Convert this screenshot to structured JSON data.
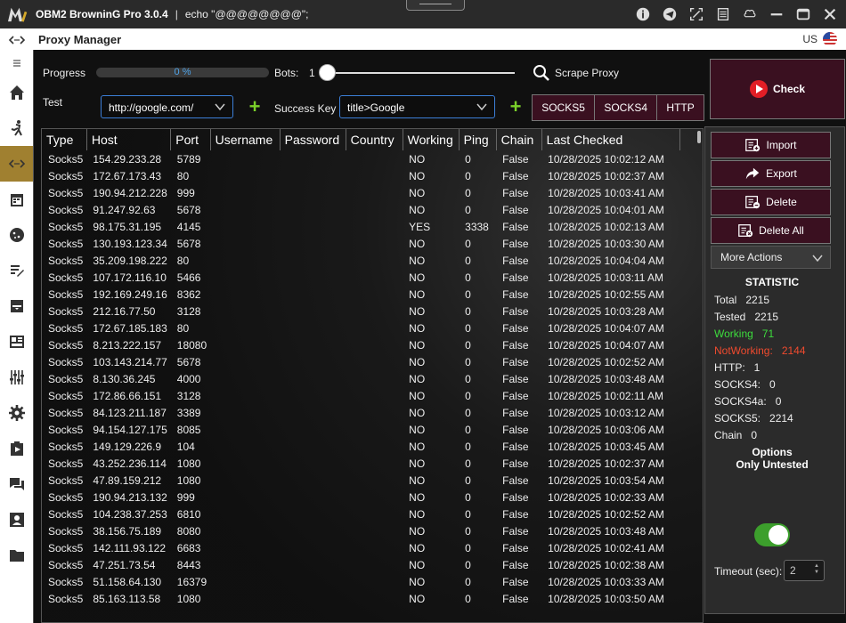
{
  "window": {
    "app_title": "OBM2 BrowninG Pro  3.0.4",
    "separator": "|",
    "echo_text": "echo \"@@@@@@@@\";"
  },
  "header": {
    "title": "Proxy Manager",
    "language": "US"
  },
  "controls": {
    "progress_label": "Progress",
    "progress_text": "0 %",
    "progress_value": 0,
    "bots_label": "Bots:",
    "bots_value": "1",
    "scrape_label": "Scrape Proxy",
    "test_label": "Test",
    "test_url": "http://google.com/",
    "success_key_label": "Success Key",
    "success_key_value": "title>Google",
    "protocols": [
      "SOCKS5",
      "SOCKS4",
      "HTTP"
    ],
    "check_label": "Check"
  },
  "table": {
    "columns": [
      "Type",
      "Host",
      "Port",
      "Username",
      "Password",
      "Country",
      "Working",
      "Ping",
      "Chain",
      "Last Checked"
    ],
    "rows": [
      [
        "Socks5",
        "154.29.233.28",
        "5789",
        "",
        "",
        "",
        "NO",
        "0",
        "False",
        "10/28/2025 10:02:12 AM"
      ],
      [
        "Socks5",
        "172.67.173.43",
        "80",
        "",
        "",
        "",
        "NO",
        "0",
        "False",
        "10/28/2025 10:02:37 AM"
      ],
      [
        "Socks5",
        "190.94.212.228",
        "999",
        "",
        "",
        "",
        "NO",
        "0",
        "False",
        "10/28/2025 10:03:41 AM"
      ],
      [
        "Socks5",
        "91.247.92.63",
        "5678",
        "",
        "",
        "",
        "NO",
        "0",
        "False",
        "10/28/2025 10:04:01 AM"
      ],
      [
        "Socks5",
        "98.175.31.195",
        "4145",
        "",
        "",
        "",
        "YES",
        "3338",
        "False",
        "10/28/2025 10:02:13 AM"
      ],
      [
        "Socks5",
        "130.193.123.34",
        "5678",
        "",
        "",
        "",
        "NO",
        "0",
        "False",
        "10/28/2025 10:03:30 AM"
      ],
      [
        "Socks5",
        "35.209.198.222",
        "80",
        "",
        "",
        "",
        "NO",
        "0",
        "False",
        "10/28/2025 10:04:04 AM"
      ],
      [
        "Socks5",
        "107.172.116.10",
        "5466",
        "",
        "",
        "",
        "NO",
        "0",
        "False",
        "10/28/2025 10:03:11 AM"
      ],
      [
        "Socks5",
        "192.169.249.16",
        "8362",
        "",
        "",
        "",
        "NO",
        "0",
        "False",
        "10/28/2025 10:02:55 AM"
      ],
      [
        "Socks5",
        "212.16.77.50",
        "3128",
        "",
        "",
        "",
        "NO",
        "0",
        "False",
        "10/28/2025 10:03:28 AM"
      ],
      [
        "Socks5",
        "172.67.185.183",
        "80",
        "",
        "",
        "",
        "NO",
        "0",
        "False",
        "10/28/2025 10:04:07 AM"
      ],
      [
        "Socks5",
        "8.213.222.157",
        "18080",
        "",
        "",
        "",
        "NO",
        "0",
        "False",
        "10/28/2025 10:04:07 AM"
      ],
      [
        "Socks5",
        "103.143.214.77",
        "5678",
        "",
        "",
        "",
        "NO",
        "0",
        "False",
        "10/28/2025 10:02:52 AM"
      ],
      [
        "Socks5",
        "8.130.36.245",
        "4000",
        "",
        "",
        "",
        "NO",
        "0",
        "False",
        "10/28/2025 10:03:48 AM"
      ],
      [
        "Socks5",
        "172.86.66.151",
        "3128",
        "",
        "",
        "",
        "NO",
        "0",
        "False",
        "10/28/2025 10:02:11 AM"
      ],
      [
        "Socks5",
        "84.123.211.187",
        "3389",
        "",
        "",
        "",
        "NO",
        "0",
        "False",
        "10/28/2025 10:03:12 AM"
      ],
      [
        "Socks5",
        "94.154.127.175",
        "8085",
        "",
        "",
        "",
        "NO",
        "0",
        "False",
        "10/28/2025 10:03:06 AM"
      ],
      [
        "Socks5",
        "149.129.226.9",
        "104",
        "",
        "",
        "",
        "NO",
        "0",
        "False",
        "10/28/2025 10:03:45 AM"
      ],
      [
        "Socks5",
        "43.252.236.114",
        "1080",
        "",
        "",
        "",
        "NO",
        "0",
        "False",
        "10/28/2025 10:02:37 AM"
      ],
      [
        "Socks5",
        "47.89.159.212",
        "1080",
        "",
        "",
        "",
        "NO",
        "0",
        "False",
        "10/28/2025 10:03:54 AM"
      ],
      [
        "Socks5",
        "190.94.213.132",
        "999",
        "",
        "",
        "",
        "NO",
        "0",
        "False",
        "10/28/2025 10:02:33 AM"
      ],
      [
        "Socks5",
        "104.238.37.253",
        "6810",
        "",
        "",
        "",
        "NO",
        "0",
        "False",
        "10/28/2025 10:02:52 AM"
      ],
      [
        "Socks5",
        "38.156.75.189",
        "8080",
        "",
        "",
        "",
        "NO",
        "0",
        "False",
        "10/28/2025 10:03:48 AM"
      ],
      [
        "Socks5",
        "142.111.93.122",
        "6683",
        "",
        "",
        "",
        "NO",
        "0",
        "False",
        "10/28/2025 10:02:41 AM"
      ],
      [
        "Socks5",
        "47.251.73.54",
        "8443",
        "",
        "",
        "",
        "NO",
        "0",
        "False",
        "10/28/2025 10:02:38 AM"
      ],
      [
        "Socks5",
        "51.158.64.130",
        "16379",
        "",
        "",
        "",
        "NO",
        "0",
        "False",
        "10/28/2025 10:03:33 AM"
      ],
      [
        "Socks5",
        "85.163.113.58",
        "1080",
        "",
        "",
        "",
        "NO",
        "0",
        "False",
        "10/28/2025 10:03:50 AM"
      ]
    ]
  },
  "actions": {
    "import": "Import",
    "export": "Export",
    "delete": "Delete",
    "delete_all": "Delete All",
    "more_actions": "More Actions"
  },
  "statistics": {
    "title": "STATISTIC",
    "total_label": "Total",
    "total": "2215",
    "tested_label": "Tested",
    "tested": "2215",
    "working_label": "Working",
    "working": "71",
    "notworking_label": "NotWorking:",
    "notworking": "2144",
    "http_label": "HTTP:",
    "http": "1",
    "socks4_label": "SOCKS4:",
    "socks4": "0",
    "socks4a_label": "SOCKS4a:",
    "socks4a": "0",
    "socks5_label": "SOCKS5:",
    "socks5": "2214",
    "chain_label": "Chain",
    "chain": "0"
  },
  "options": {
    "title": "Options",
    "only_untested_label": "Only Untested",
    "only_untested_on": true,
    "timeout_label": "Timeout (sec):",
    "timeout_value": "2"
  },
  "colors": {
    "accent_gold": "#a08030",
    "button_maroon": "#3a1020",
    "check_red": "#e21e26",
    "green": "#3ddc3d",
    "red": "#ef4a2e",
    "select_border": "#3c7fd8"
  },
  "icons": {
    "title_bar": [
      "info-icon",
      "telegram-icon",
      "fullscreen-icon",
      "list-icon",
      "cloud-icon",
      "minimize-icon",
      "maximize-icon",
      "close-icon"
    ],
    "sidebar": [
      "code-icon",
      "menu-icon",
      "home-icon",
      "runner-icon",
      "proxy-icon",
      "calendar-icon",
      "cookie-icon",
      "notes-icon",
      "archive-icon",
      "dashboard-icon",
      "equalizer-icon",
      "gear-icon",
      "clipboard-play-icon",
      "chat-icon",
      "contact-icon",
      "folder-icon"
    ]
  }
}
